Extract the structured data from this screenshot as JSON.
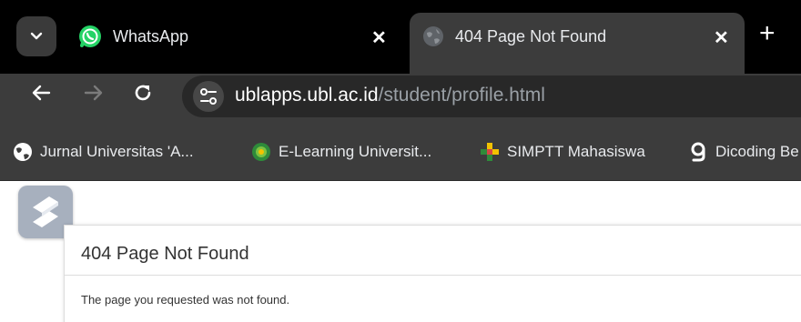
{
  "browser": {
    "tabs": [
      {
        "title": "WhatsApp",
        "active": false,
        "icon": "whatsapp-icon"
      },
      {
        "title": "404 Page Not Found",
        "active": true,
        "icon": "globe-icon"
      }
    ],
    "toolbar": {
      "url_host": "ublapps.ubl.ac.id",
      "url_path": "/student/profile.html"
    },
    "bookmarks": [
      {
        "label": "Jurnal Universitas 'A...",
        "icon": "globe-icon"
      },
      {
        "label": "E-Learning Universit...",
        "icon": "university-logo-icon"
      },
      {
        "label": "SIMPTT Mahasiswa",
        "icon": "simptt-icon"
      },
      {
        "label": "Dicoding Be",
        "icon": "dicoding-icon"
      }
    ]
  },
  "page": {
    "heading": "404 Page Not Found",
    "message": "The page you requested was not found."
  },
  "colors": {
    "tabstrip": "#000000",
    "toolbar": "#3c3c3c",
    "omnibox": "#282828",
    "whatsapp": "#25d366"
  }
}
